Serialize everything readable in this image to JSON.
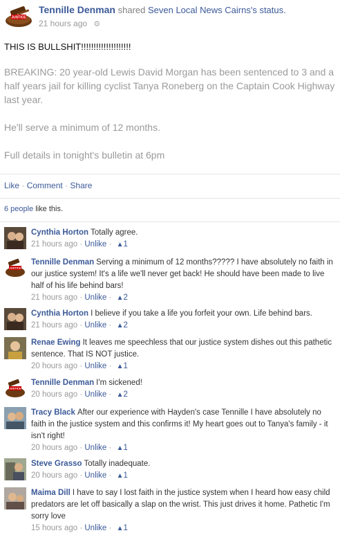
{
  "header": {
    "author": "Tennille Denman",
    "shared_text": "shared",
    "page_name": "Seven Local News Cairns",
    "possessive": "'s status.",
    "time": "21 hours ago"
  },
  "post": {
    "message": "THIS IS BULLSHIT!!!!!!!!!!!!!!!!!!!!",
    "shared_paragraphs": [
      "BREAKING: 20 year-old Lewis David Morgan has been sentenced to 3 and a half years jail for killing cyclist Tanya Roneberg on the Captain Cook Highway last year.",
      "He'll serve a minimum of 12 months.",
      "Full details in tonight's bulletin at 6pm"
    ]
  },
  "actions": {
    "like": "Like",
    "comment": "Comment",
    "share": "Share",
    "sep": "·"
  },
  "likes": {
    "people": "6 people",
    "text": "like this."
  },
  "comments": [
    {
      "name": "Cynthia Horton",
      "text": "Totally agree.",
      "time": "21 hours ago",
      "unlike": "Unlike",
      "likes": "1"
    },
    {
      "name": "Tennille Denman",
      "text": "Serving a minimum of 12 months????? I have absolutely no faith in our justice system! It's a life we'll never get back! He should have been made to live half of his life behind bars!",
      "time": "21 hours ago",
      "unlike": "Unlike",
      "likes": "2"
    },
    {
      "name": "Cynthia Horton",
      "text": "I believe if you take a life you forfeit your own. Life behind bars.",
      "time": "21 hours ago",
      "unlike": "Unlike",
      "likes": "2"
    },
    {
      "name": "Renae Ewing",
      "text": "It leaves me speechless that our justice system dishes out this pathetic sentence. That IS NOT justice.",
      "time": "20 hours ago",
      "unlike": "Unlike",
      "likes": "1"
    },
    {
      "name": "Tennille Denman",
      "text": "I'm sickened!",
      "time": "20 hours ago",
      "unlike": "Unlike",
      "likes": "2"
    },
    {
      "name": "Tracy Black",
      "text": "After our experience with Hayden's case Tennille I have absolutely no faith in the justice system and this confirms it! My heart goes out to Tanya's family - it isn't right!",
      "time": "20 hours ago",
      "unlike": "Unlike",
      "likes": "1"
    },
    {
      "name": "Steve Grasso",
      "text": "Totally inadequate.",
      "time": "20 hours ago",
      "unlike": "Unlike",
      "likes": "1"
    },
    {
      "name": "Maima Dill",
      "text": "I have to say I lost faith in the justice system when I heard how easy child predators are let off basically a slap on the wrist. This just drives it home. Pathetic I'm sorry love",
      "time": "15 hours ago",
      "unlike": "Unlike",
      "likes": "1"
    }
  ],
  "icons": {
    "settings": "gear-icon",
    "like_thumb": "thumbs-up-icon"
  },
  "colors": {
    "link": "#3b5998",
    "muted": "#999999",
    "shared_text": "#9a9a9a"
  },
  "logo_text": "JUSTICE"
}
